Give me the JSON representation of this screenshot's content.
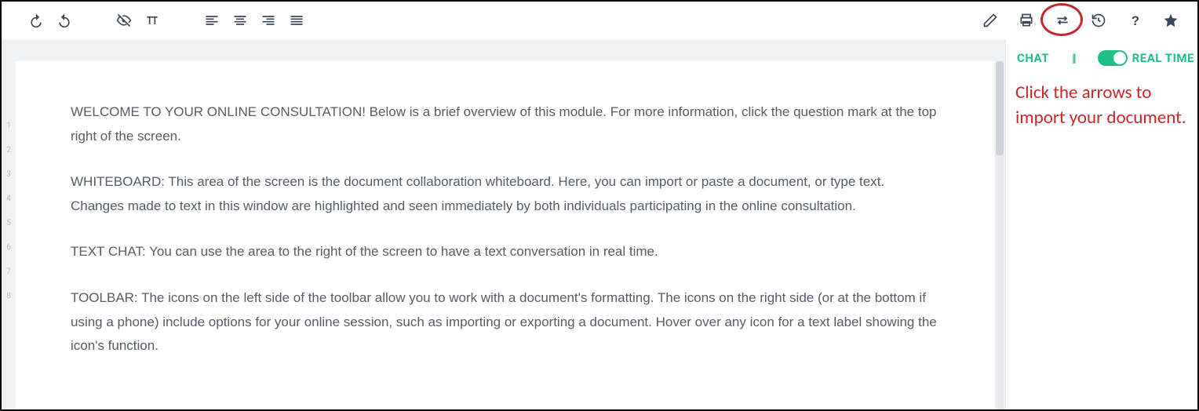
{
  "toolbar": {
    "left_groups": [
      [
        "undo",
        "redo"
      ],
      [
        "strike",
        "pi"
      ],
      [
        "align-left",
        "align-center",
        "align-right",
        "align-justify"
      ]
    ],
    "right_icons": [
      "pencil",
      "print",
      "transfer",
      "history",
      "help",
      "star"
    ]
  },
  "line_numbers": [
    "1",
    "2",
    "3",
    "4",
    "5",
    "6",
    "7",
    "8"
  ],
  "document": {
    "p1": "WELCOME TO YOUR ONLINE CONSULTATION! Below is a brief overview of this module. For more information, click the question mark at the top right of the screen.",
    "p2": "WHITEBOARD: This area of the screen is the document collaboration whiteboard. Here, you can import or paste a document, or type text. Changes made to text in this window are highlighted and seen immediately by both individuals participating in the online consultation.",
    "p3": "TEXT CHAT: You can use the area to the right of the screen to have a text conversation in real time.",
    "p4": "TOOLBAR: The icons on the left side of the toolbar allow you to work with a document's formatting. The icons on the right side (or at the bottom if using a phone) include options for your online session, such as importing or exporting a document. Hover over any icon for a text label showing the icon's function."
  },
  "panel": {
    "chat_label": "CHAT",
    "divider": "||",
    "realtime_label": "REAL TIME"
  },
  "annotation": {
    "text": "Click the arrows to import your document."
  }
}
